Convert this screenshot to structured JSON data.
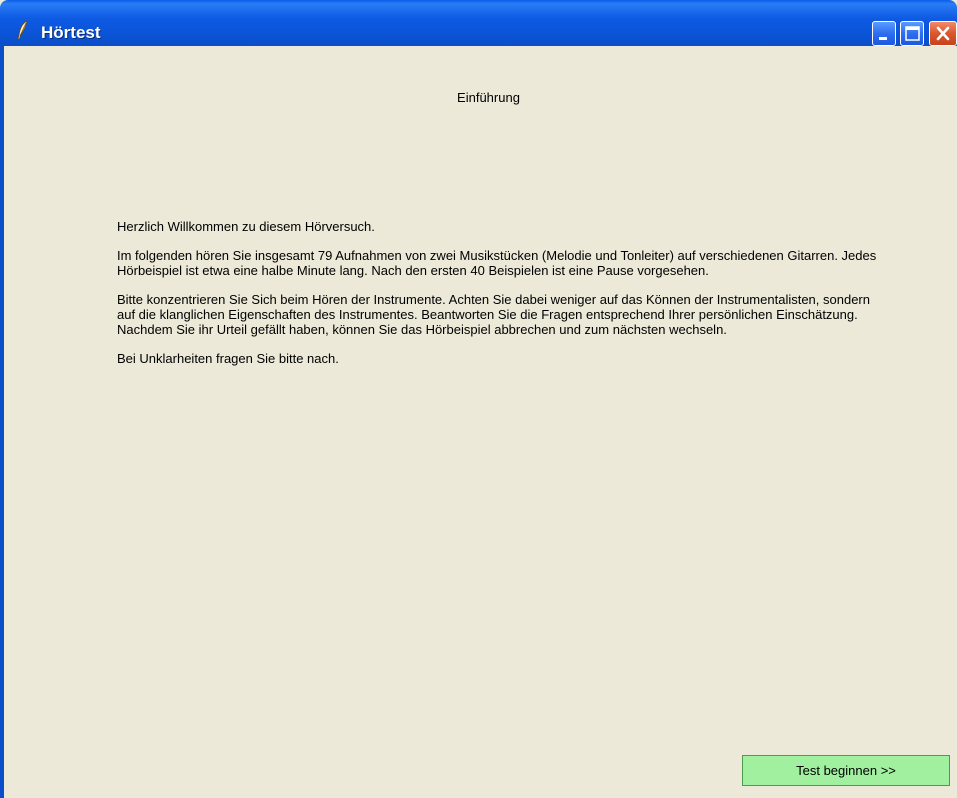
{
  "window": {
    "title": "Hörtest",
    "icon": "feather-icon",
    "controls": {
      "minimize": "minimize-icon",
      "maximize": "maximize-icon",
      "close": "close-icon"
    }
  },
  "main": {
    "heading": "Einführung",
    "paragraphs": [
      "Herzlich Willkommen zu diesem Hörversuch.",
      "Im folgenden hören Sie insgesamt 79 Aufnahmen von zwei Musikstücken (Melodie und Tonleiter) auf verschiedenen Gitarren. Jedes Hörbeispiel ist etwa eine halbe Minute lang. Nach den ersten 40 Beispielen ist eine Pause vorgesehen.",
      "Bitte konzentrieren Sie Sich beim Hören der Instrumente. Achten Sie dabei weniger auf das Können der Instrumentalisten, sondern auf die klanglichen Eigenschaften des Instrumentes. Beantworten Sie die Fragen entsprechend Ihrer persönlichen Einschätzung. Nachdem Sie ihr Urteil gefällt haben, können Sie das Hörbeispiel abbrechen und zum nächsten wechseln.",
      "Bei Unklarheiten fragen Sie bitte nach."
    ]
  },
  "footer": {
    "start_button_label": "Test beginnen >>"
  },
  "colors": {
    "titlebar": "#0b55d9",
    "background": "#ece9d8",
    "start_button": "#a0f0a0",
    "close_button": "#d9582e"
  }
}
